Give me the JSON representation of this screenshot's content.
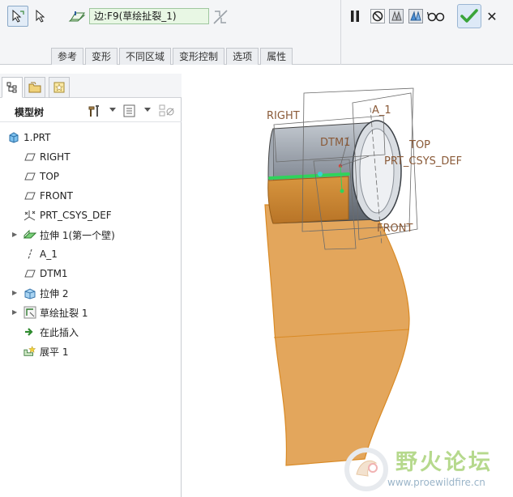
{
  "dashboard": {
    "reference_field": "边:F9(草绘扯裂_1)",
    "tabs": [
      "参考",
      "变形",
      "不同区域",
      "变形控制",
      "选项",
      "属性"
    ],
    "cancel_glyph": "✕"
  },
  "model_tree": {
    "title": "模型树",
    "items": [
      {
        "label": "1.PRT",
        "icon": "part-icon"
      },
      {
        "label": "RIGHT",
        "icon": "datum-plane-icon"
      },
      {
        "label": "TOP",
        "icon": "datum-plane-icon"
      },
      {
        "label": "FRONT",
        "icon": "datum-plane-icon"
      },
      {
        "label": "PRT_CSYS_DEF",
        "icon": "csys-icon"
      },
      {
        "label": "拉伸 1(第一个壁)",
        "icon": "extrude-wall-icon"
      },
      {
        "label": "A_1",
        "icon": "datum-axis-icon"
      },
      {
        "label": "DTM1",
        "icon": "datum-plane-icon"
      },
      {
        "label": "拉伸 2",
        "icon": "extrude-icon"
      },
      {
        "label": "草绘扯裂 1",
        "icon": "sketch-rip-icon"
      },
      {
        "label": "在此插入",
        "icon": "insert-here-icon"
      },
      {
        "label": "展平 1",
        "icon": "flatten-icon"
      }
    ]
  },
  "viewport": {
    "labels": {
      "right": "RIGHT",
      "a1": "A_1",
      "dtm1": "DTM1",
      "top": "TOP",
      "csys": "PRT_CSYS_DEF",
      "front": "FRONT"
    }
  },
  "watermark": {
    "text": "野火论坛",
    "url": "www.proewildfire.cn"
  },
  "colors": {
    "sheet_orange": "#e3a65c",
    "cylinder_gray": "#8f96a0",
    "highlight_green": "#2fd35b",
    "ok_green": "#3aa43a",
    "datum_label": "#8a5a38"
  }
}
